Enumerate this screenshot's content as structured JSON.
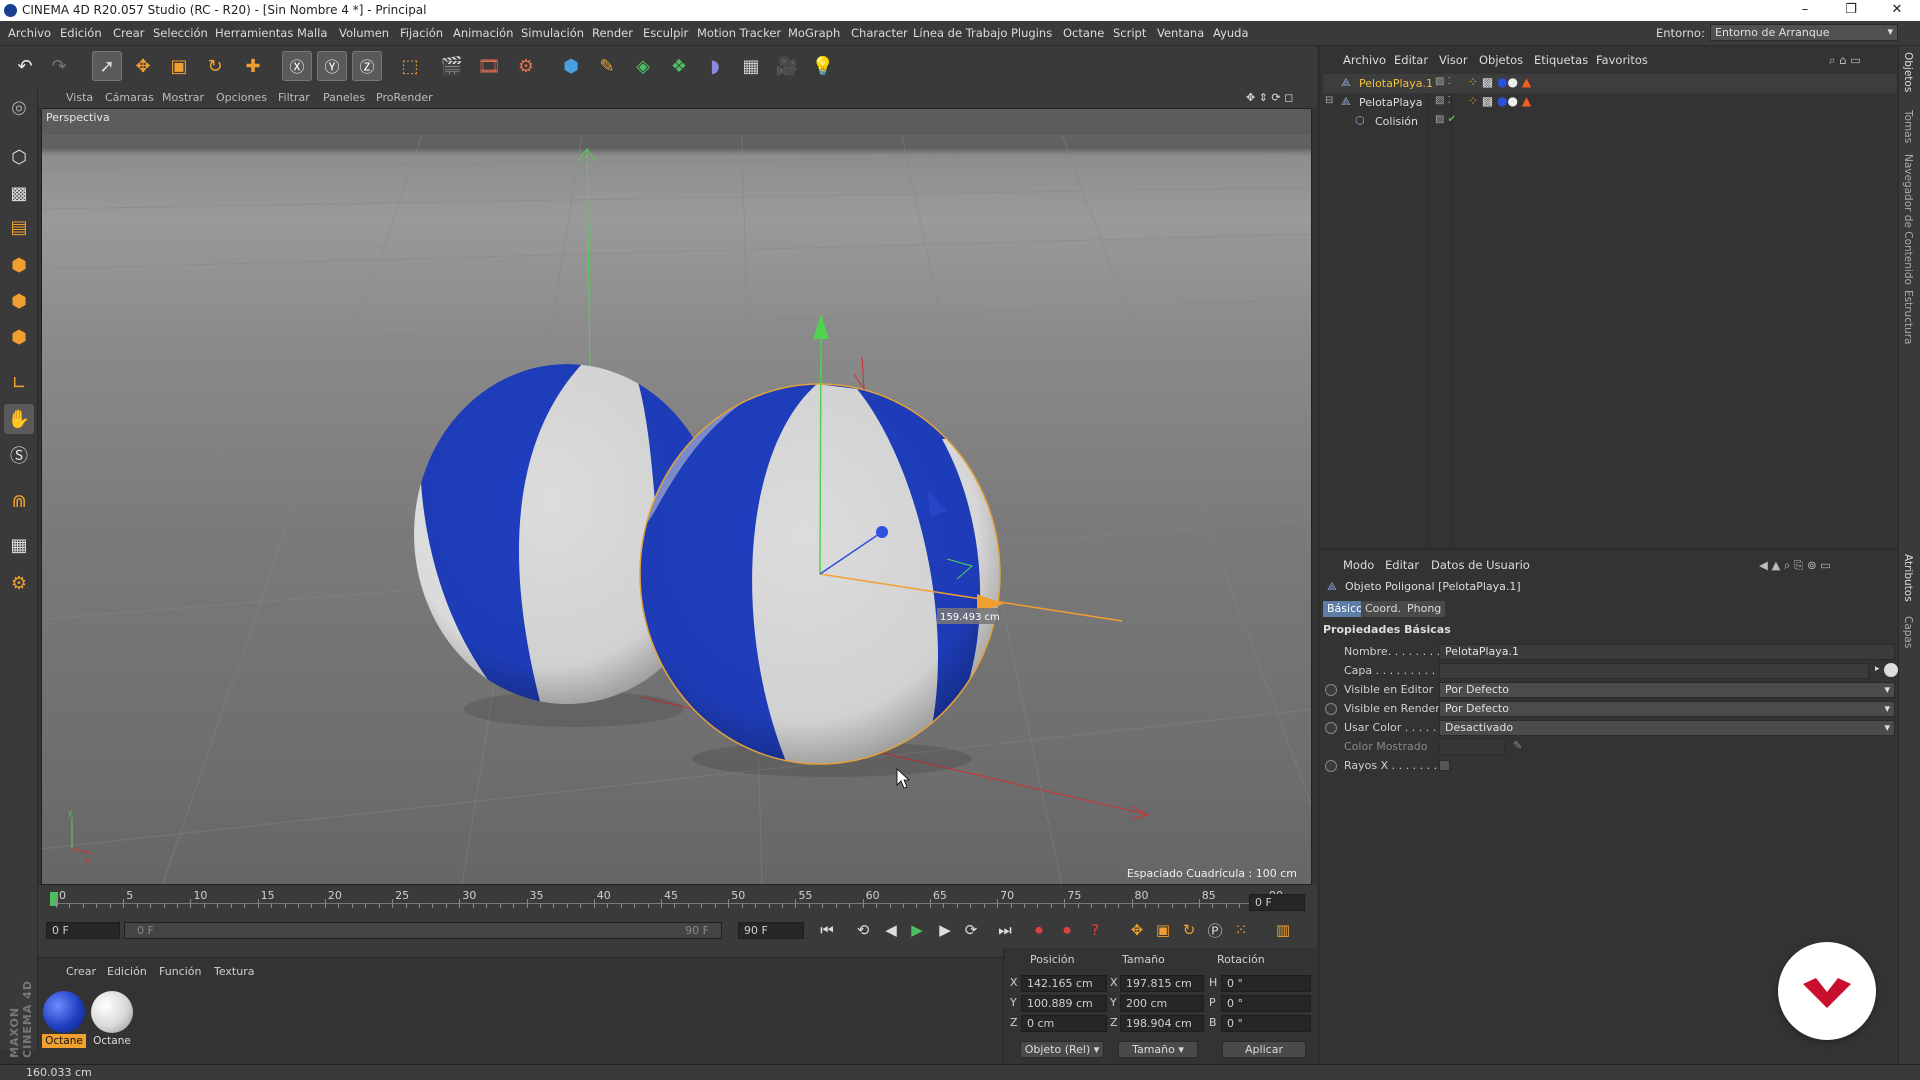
{
  "window": {
    "title": "CINEMA 4D R20.057 Studio (RC - R20) - [Sin Nombre 4 *] - Principal",
    "controls": [
      "–",
      "❐",
      "✕"
    ]
  },
  "menubar": {
    "items": [
      "Archivo",
      "Edición",
      "Crear",
      "Selección",
      "Herramientas",
      "Malla",
      "Volumen",
      "Fijación",
      "Animación",
      "Simulación",
      "Render",
      "Esculpir",
      "Motion Tracker",
      "MoGraph",
      "Character",
      "Línea de Trabajo",
      "Plugins",
      "Octane",
      "Script",
      "Ventana",
      "Ayuda"
    ],
    "environment_label": "Entorno:",
    "environment_value": "Entorno de Arranque"
  },
  "viewport_menu": {
    "items": [
      "Vista",
      "Cámaras",
      "Mostrar",
      "Opciones",
      "Filtrar",
      "Paneles",
      "ProRender"
    ]
  },
  "viewport": {
    "camera_label": "Perspectiva",
    "distance_readout": "159.493 cm",
    "grid_spacing": "Espaciado Cuadrícula : 100 cm"
  },
  "timeline": {
    "ticks": [
      "0",
      "5",
      "10",
      "15",
      "20",
      "25",
      "30",
      "35",
      "40",
      "45",
      "50",
      "55",
      "60",
      "65",
      "70",
      "75",
      "80",
      "85",
      "90"
    ],
    "current_frame_display": "0 F",
    "start_field": "0 F",
    "range_start": "0 F",
    "range_end": "90 F",
    "end_field": "90 F"
  },
  "material_manager": {
    "menu": [
      "Crear",
      "Edición",
      "Función",
      "Textura"
    ],
    "materials": [
      {
        "label": "Octane",
        "color": "#1f3fc0",
        "selected": true
      },
      {
        "label": "Octane",
        "color": "#e8e8e8",
        "selected": false
      }
    ]
  },
  "coordinates": {
    "headers": [
      "Posición",
      "Tamaño",
      "Rotación"
    ],
    "rows": [
      {
        "axis": "X",
        "position": "142.165 cm",
        "size_axis": "X",
        "size": "197.815 cm",
        "rot_axis": "H",
        "rotation": "0 °"
      },
      {
        "axis": "Y",
        "position": "100.889 cm",
        "size_axis": "Y",
        "size": "200 cm",
        "rot_axis": "P",
        "rotation": "0 °"
      },
      {
        "axis": "Z",
        "position": "0 cm",
        "size_axis": "Z",
        "size": "198.904 cm",
        "rot_axis": "B",
        "rotation": "0 °"
      }
    ],
    "mode_select": "Objeto (Rel)",
    "size_select": "Tamaño",
    "apply_button": "Aplicar"
  },
  "object_manager": {
    "menu": [
      "Archivo",
      "Editar",
      "Visor",
      "Objetos",
      "Etiquetas",
      "Favoritos"
    ],
    "objects": [
      {
        "name": "PelotaPlaya.1",
        "selected": true,
        "indent": 0
      },
      {
        "name": "PelotaPlaya",
        "selected": false,
        "indent": 0
      },
      {
        "name": "Colisión",
        "selected": false,
        "indent": 1
      }
    ]
  },
  "attribute_manager": {
    "menu": [
      "Modo",
      "Editar",
      "Datos de Usuario"
    ],
    "object_title": "Objeto Poligonal [PelotaPlaya.1]",
    "tabs": [
      "Básico",
      "Coord.",
      "Phong"
    ],
    "section": "Propiedades Básicas",
    "properties": [
      {
        "label": "Nombre. . . . . . . .",
        "value": "PelotaPlaya.1"
      },
      {
        "label": "Capa . . . . . . . . . .",
        "value": ""
      },
      {
        "label": "Visible en Editor",
        "value": "Por Defecto"
      },
      {
        "label": "Visible en Render",
        "value": "Por Defecto"
      },
      {
        "label": "Usar Color . . . . .",
        "value": "Desactivado"
      },
      {
        "label": "Color Mostrado",
        "value": ""
      },
      {
        "label": "Rayos X . . . . . . .",
        "value": ""
      }
    ]
  },
  "side_tabs": [
    "Objetos",
    "Tomas",
    "Navegador de Contenido",
    "Estructura",
    "Atributos",
    "Capas"
  ],
  "status_bar": "160.033 cm",
  "brand": "MAXON CINEMA 4D",
  "colors": {
    "accent_blue": "#5b7da8",
    "ball_blue": "#1f3fc0",
    "selection_orange": "#e3a23b",
    "selected_object_text": "#f0c040"
  }
}
